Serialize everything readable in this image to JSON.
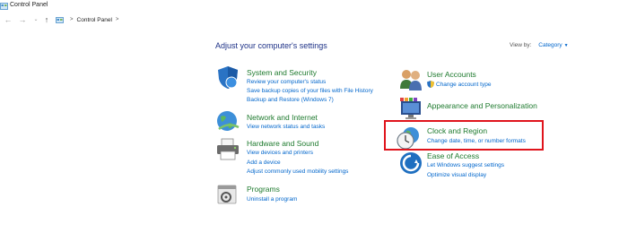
{
  "window": {
    "title": "Control Panel"
  },
  "nav": {
    "back_icon": "back-arrow-icon",
    "forward_icon": "forward-arrow-icon",
    "recent_icon": "chevron-down-icon",
    "up_icon": "up-arrow-icon",
    "breadcrumb": [
      "Control Panel"
    ],
    "separator": ">"
  },
  "main": {
    "heading": "Adjust your computer's settings",
    "view_by_label": "View by:",
    "view_by_value": "Category"
  },
  "categories_left": [
    {
      "title": "System and Security",
      "links": [
        "Review your computer's status",
        "Save backup copies of your files with File History",
        "Backup and Restore (Windows 7)"
      ]
    },
    {
      "title": "Network and Internet",
      "links": [
        "View network status and tasks"
      ]
    },
    {
      "title": "Hardware and Sound",
      "links": [
        "View devices and printers",
        "Add a device",
        "Adjust commonly used mobility settings"
      ]
    },
    {
      "title": "Programs",
      "links": [
        "Uninstall a program"
      ]
    }
  ],
  "categories_right": [
    {
      "title": "User Accounts",
      "links": [
        "Change account type"
      ]
    },
    {
      "title": "Appearance and Personalization",
      "links": []
    },
    {
      "title": "Clock and Region",
      "links": [
        "Change date, time, or number formats"
      ]
    },
    {
      "title": "Ease of Access",
      "links": [
        "Let Windows suggest settings",
        "Optimize visual display"
      ]
    }
  ],
  "colors": {
    "category_title": "#1e7a2e",
    "link": "#0066cc",
    "heading": "#1e3287",
    "highlight": "#e0141c"
  }
}
